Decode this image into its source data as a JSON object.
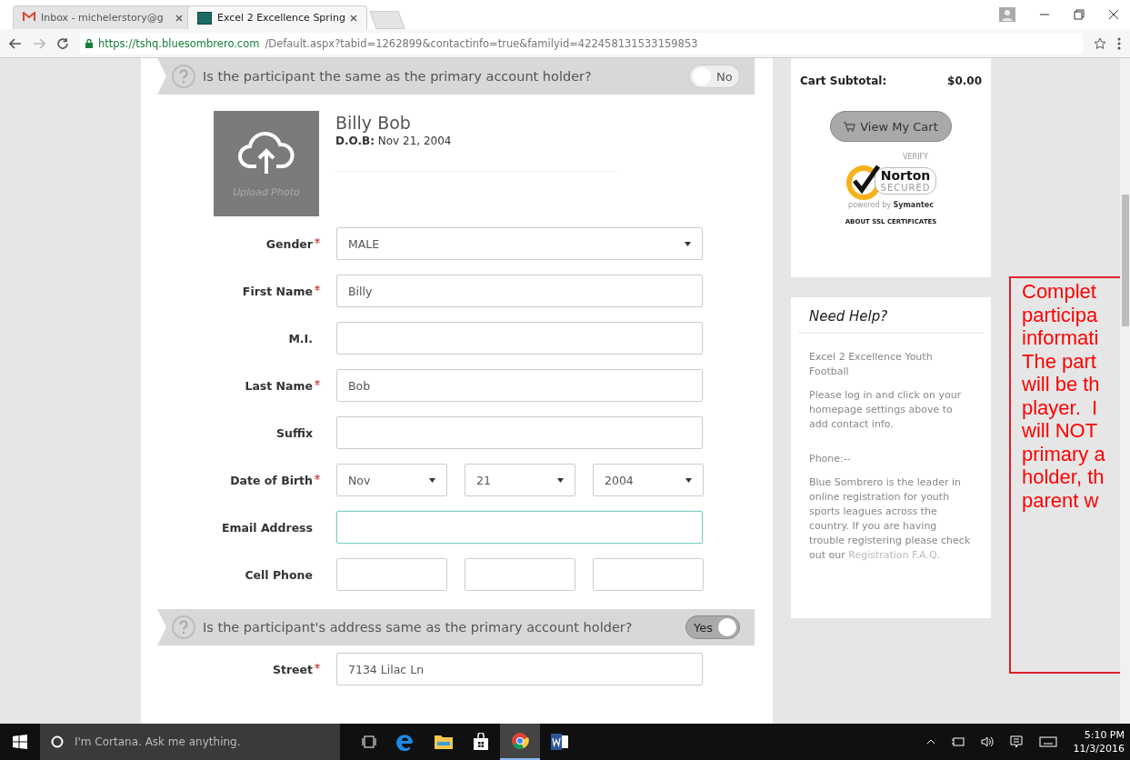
{
  "browser": {
    "tabs": [
      {
        "title": "Inbox - michelerstory@g",
        "selected": false,
        "kind": "mail"
      },
      {
        "title": "Excel 2 Excellence Spring",
        "selected": true,
        "kind": "site"
      }
    ],
    "url_host": "https://tshq.bluesombrero.com",
    "url_path": "/Default.aspx?tabid=1262899&contactinfo=true&familyid=422458131533159853"
  },
  "question_1": {
    "text": "Is the participant the same as the primary account holder?",
    "on": false,
    "toggle_label": "No"
  },
  "participant": {
    "name": "Billy Bob",
    "dob_label": "D.O.B:",
    "dob": "Nov 21, 2004",
    "upload_label": "Upload Photo"
  },
  "fields": [
    {
      "label": "Gender",
      "required": true,
      "kind": "select",
      "values": [
        "MALE"
      ]
    },
    {
      "label": "First Name",
      "required": true,
      "kind": "text",
      "values": [
        "Billy"
      ]
    },
    {
      "label": "M.I.",
      "required": false,
      "kind": "text"
    },
    {
      "label": "Last Name",
      "required": true,
      "kind": "text",
      "values": [
        "Bob"
      ]
    },
    {
      "label": "Suffix",
      "required": false,
      "kind": "text"
    },
    {
      "label": "Date of Birth",
      "required": true,
      "kind": "selects",
      "values": [
        "Nov",
        "21",
        "2004"
      ]
    },
    {
      "label": "Email Address",
      "required": false,
      "kind": "focused"
    },
    {
      "label": "Cell Phone",
      "required": false,
      "kind": "phone"
    }
  ],
  "question_2": {
    "text": "Is the participant's address same as the primary account holder?",
    "on": true,
    "toggle_label": "Yes"
  },
  "address_fields": [
    {
      "label": "Street",
      "required": true,
      "kind": "text",
      "values": [
        "7134 Lilac Ln"
      ]
    }
  ],
  "cart": {
    "label": "Cart Subtotal:",
    "amount": "$0.00",
    "button": "View My Cart",
    "seal_verify": "VERIFY",
    "seal_name": "Norton",
    "seal_secured": "SECURED",
    "seal_powered": "powered by",
    "seal_brand": "Symantec",
    "ssl_link": "ABOUT SSL CERTIFICATES"
  },
  "help": {
    "title": "Need Help?",
    "org": "Excel 2 Excellence Youth Football",
    "note": "Please log in and click on your homepage settings above to add contact info.",
    "phone": "Phone:--",
    "about": "Blue Sombrero is the leader in online registration for youth sports leagues across the country. If you are having trouble registering please check out our",
    "faq_link": "Registration F.A.Q."
  },
  "annotation": {
    "lines": [
      "Complet",
      "participa",
      "informati",
      "The part",
      "will be th",
      "player.  I",
      "will NOT",
      "primary a",
      "holder, th",
      "parent w"
    ]
  },
  "taskbar": {
    "search_placeholder": "I'm Cortana. Ask me anything.",
    "time": "5:10 PM",
    "date": "11/3/2016"
  }
}
